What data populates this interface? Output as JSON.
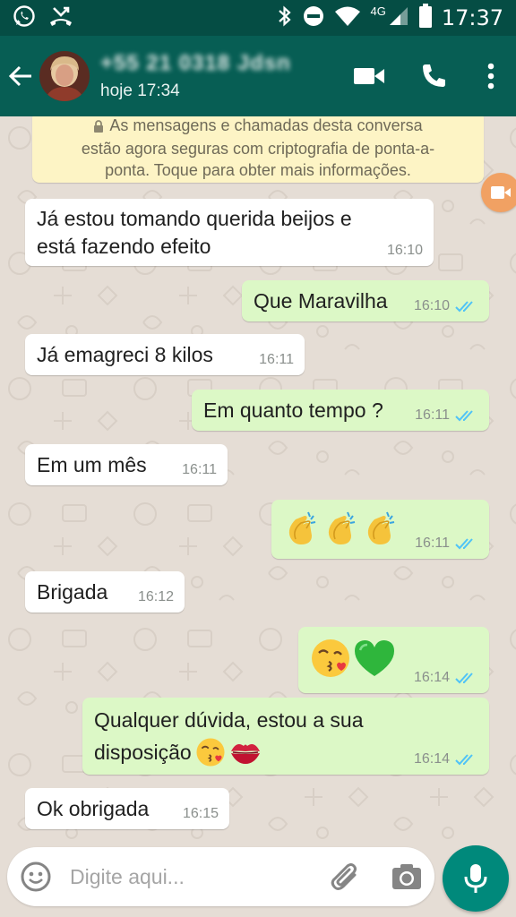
{
  "status_bar": {
    "time": "17:37",
    "network": "4G",
    "icons": [
      "whatsapp-icon",
      "missed-call-icon",
      "bluetooth-icon",
      "do-not-disturb-icon",
      "wifi-icon",
      "signal-icon",
      "battery-icon"
    ]
  },
  "header": {
    "contact_name": "+55 21 0318 Jdsn",
    "contact_status": "hoje 17:34",
    "icons": [
      "back-arrow-icon",
      "video-call-icon",
      "phone-icon",
      "more-options-icon"
    ]
  },
  "encryption_notice": {
    "line1": "As mensagens e chamadas desta conversa",
    "line2": "estão agora seguras com criptografia de ponta-a-",
    "line3": "ponta. Toque para obter mais informações."
  },
  "messages": [
    {
      "direction": "in",
      "line1": "Já estou tomando querida beijos e",
      "line2": "está fazendo efeito",
      "time": "16:10"
    },
    {
      "direction": "out",
      "text": "Que Maravilha",
      "time": "16:10",
      "status": "read"
    },
    {
      "direction": "in",
      "text": "Já emagreci 8 kilos",
      "time": "16:11"
    },
    {
      "direction": "out",
      "text": "Em quanto tempo ?",
      "time": "16:11",
      "status": "read"
    },
    {
      "direction": "in",
      "text": "Em um mês",
      "time": "16:11"
    },
    {
      "direction": "out",
      "emojis": [
        "clapping-hands",
        "clapping-hands",
        "clapping-hands"
      ],
      "time": "16:11",
      "status": "read"
    },
    {
      "direction": "in",
      "text": "Brigada",
      "time": "16:12"
    },
    {
      "direction": "out",
      "emojis": [
        "face-blowing-kiss",
        "green-heart"
      ],
      "time": "16:14",
      "status": "read"
    },
    {
      "direction": "out",
      "line1": "Qualquer dúvida, estou a sua",
      "line2": "disposição",
      "emojis": [
        "face-blowing-kiss",
        "kiss-mark"
      ],
      "time": "16:14",
      "status": "read"
    },
    {
      "direction": "in",
      "text": "Ok obrigada",
      "time": "16:15"
    }
  ],
  "input": {
    "placeholder": "Digite aqui...",
    "icons": [
      "emoji-icon",
      "paperclip-icon",
      "camera-icon",
      "microphone-icon"
    ]
  },
  "colors": {
    "status_bar": "#054d44",
    "app_bar": "#075e54",
    "chat_background": "#e5ddd5",
    "incoming_bubble": "#ffffff",
    "outgoing_bubble": "#dcf8c6",
    "read_ticks": "#4fc3f7",
    "mic_button": "#00897b",
    "encryption_notice": "#fdf4c5"
  }
}
